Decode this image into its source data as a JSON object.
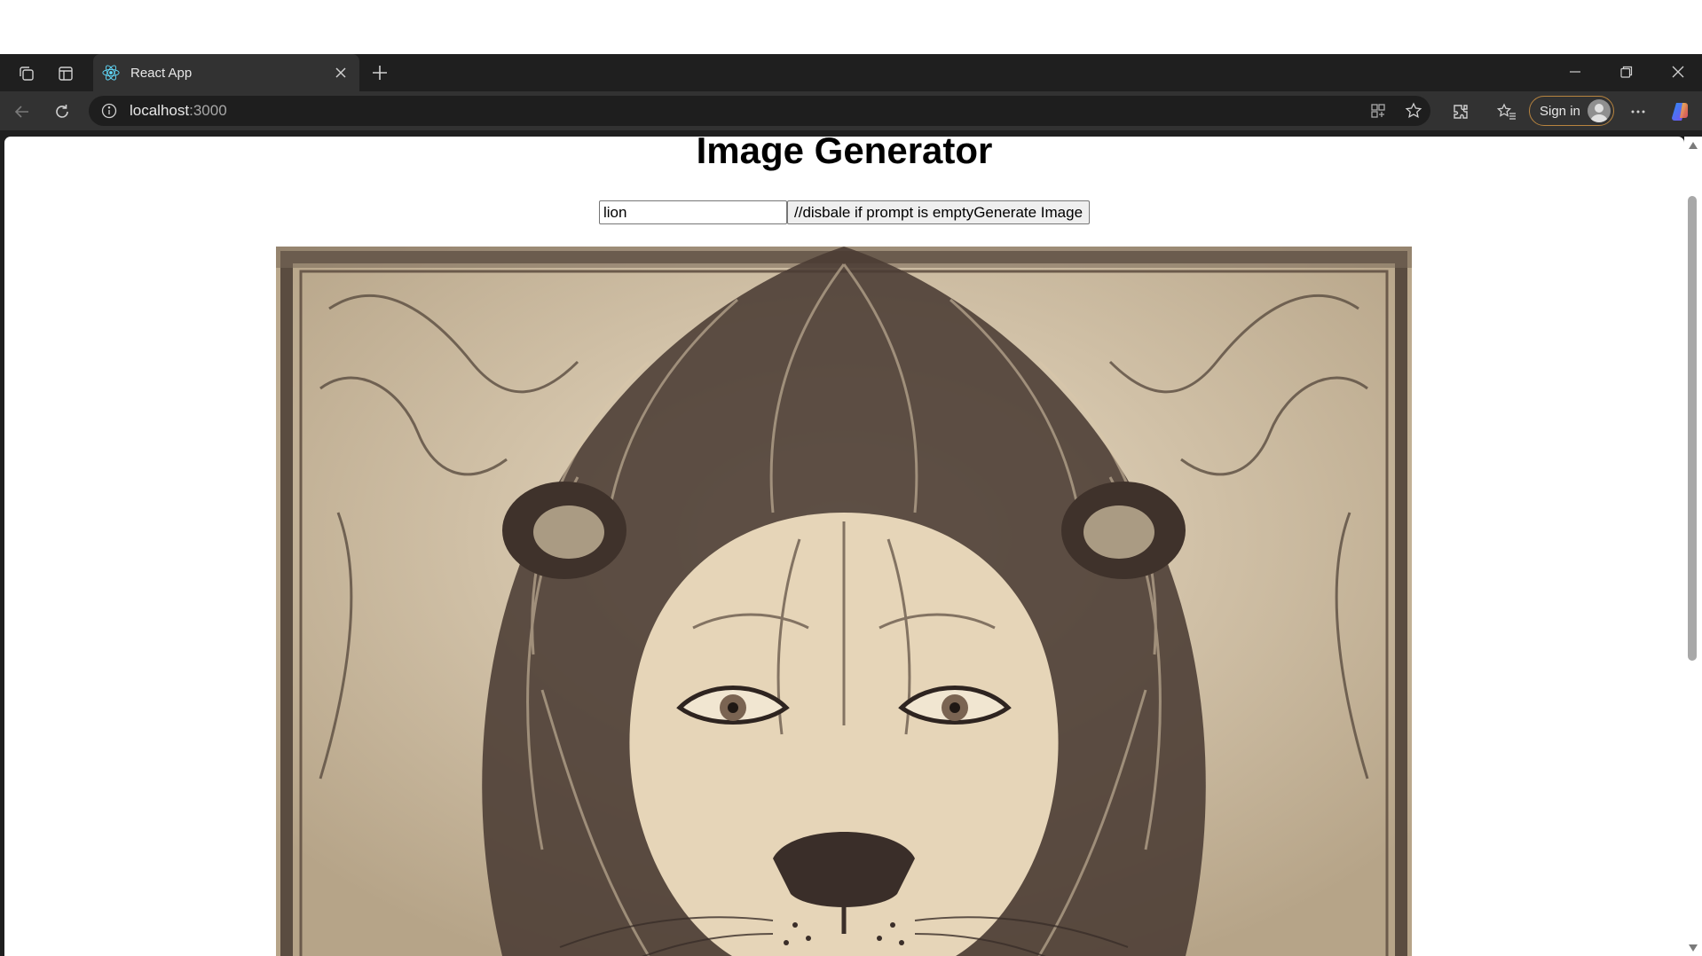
{
  "browser": {
    "tab": {
      "title": "React App",
      "favicon": "react-icon"
    },
    "address": {
      "host": "localhost",
      "port": ":3000"
    },
    "signin_label": "Sign in",
    "accent_colors": {
      "tab_bg": "#323232",
      "chrome_bg": "#1f1f1f",
      "signin_border": "#b8843f"
    }
  },
  "app": {
    "title": "Image Generator",
    "prompt": {
      "value": "lion",
      "placeholder": ""
    },
    "generate_button_label": "//disbale if prompt is emptyGenerate Image",
    "image_alt": "Generated lion illustration"
  }
}
